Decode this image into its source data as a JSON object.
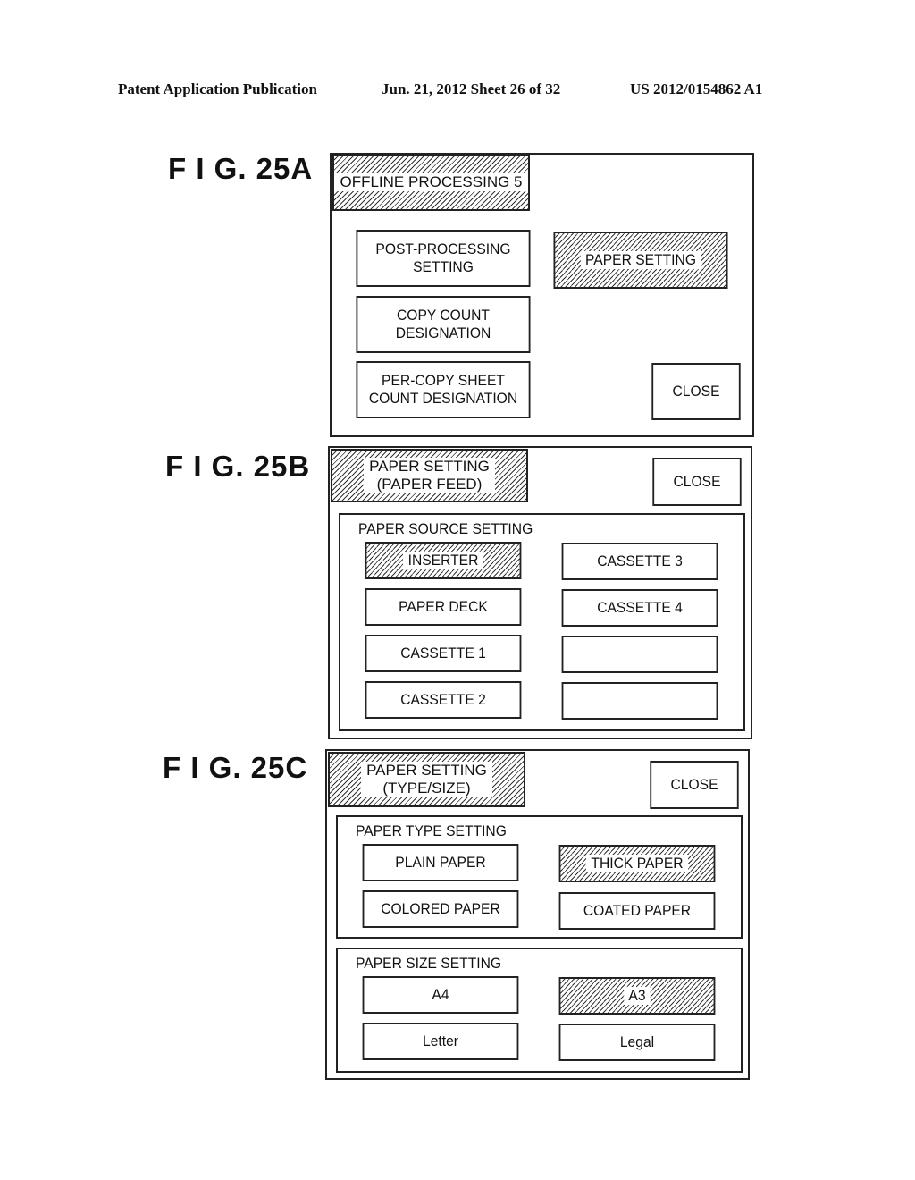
{
  "header": {
    "publication": "Patent Application Publication",
    "date_sheet": "Jun. 21, 2012  Sheet 26 of 32",
    "number": "US 2012/0154862 A1"
  },
  "figures": {
    "a": {
      "label": "F I G.  25A",
      "title": "OFFLINE PROCESSING 5",
      "buttons": {
        "post_processing": "POST-PROCESSING\nSETTING",
        "paper_setting": "PAPER SETTING",
        "copy_count": "COPY COUNT\nDESIGNATION",
        "per_copy": "PER-COPY SHEET\nCOUNT DESIGNATION",
        "close": "CLOSE"
      },
      "selected": "PAPER SETTING"
    },
    "b": {
      "label": "F I G.  25B",
      "title": "PAPER SETTING\n(PAPER FEED)",
      "close": "CLOSE",
      "group_title": "PAPER SOURCE SETTING",
      "left": [
        "INSERTER",
        "PAPER DECK",
        "CASSETTE 1",
        "CASSETTE 2"
      ],
      "right": [
        "CASSETTE 3",
        "CASSETTE 4",
        "",
        ""
      ],
      "selected": "INSERTER"
    },
    "c": {
      "label": "F I G.  25C",
      "title": "PAPER SETTING\n(TYPE/SIZE)",
      "close": "CLOSE",
      "type_group": {
        "title": "PAPER TYPE SETTING",
        "options": [
          "PLAIN PAPER",
          "THICK PAPER",
          "COLORED PAPER",
          "COATED PAPER"
        ],
        "selected": "THICK PAPER"
      },
      "size_group": {
        "title": "PAPER SIZE SETTING",
        "options": [
          "A4",
          "A3",
          "Letter",
          "Legal"
        ],
        "selected": "A3"
      }
    }
  }
}
